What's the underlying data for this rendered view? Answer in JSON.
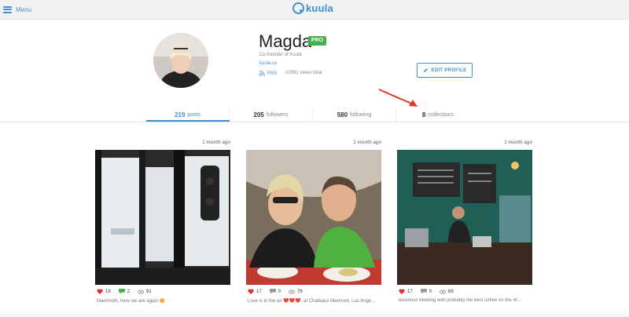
{
  "nav": {
    "menu_label": "Menu",
    "logo_text": "kuula"
  },
  "profile": {
    "name": "Magda",
    "badge": "PRO",
    "subtitle": "Co-founder of Kuula",
    "website": "kuula.co",
    "rss_label": "RSS",
    "views": "10991 views total",
    "edit_label": "EDIT PROFILE"
  },
  "stats": [
    {
      "num": "219",
      "label": "posts"
    },
    {
      "num": "205",
      "label": "followers"
    },
    {
      "num": "580",
      "label": "following"
    },
    {
      "num": "8",
      "label": "collections"
    }
  ],
  "posts": [
    {
      "time": "1 month ago",
      "likes": "19",
      "comments": "2",
      "views": "91",
      "caption": "Mammoth, here we are again 😊"
    },
    {
      "time": "1 month ago",
      "likes": "17",
      "comments": "0",
      "views": "76",
      "caption": "Love is in the air ❤️❤️❤️, at Chateaux Marmont, Los Ange..."
    },
    {
      "time": "1 month ago",
      "likes": "17",
      "comments": "0",
      "views": "69",
      "caption": "Business Meeting with probably the best coffee on the W..."
    }
  ],
  "colors": {
    "accent": "#3f8fcf",
    "badge": "#3fb34a",
    "arrow": "#e8382c"
  }
}
